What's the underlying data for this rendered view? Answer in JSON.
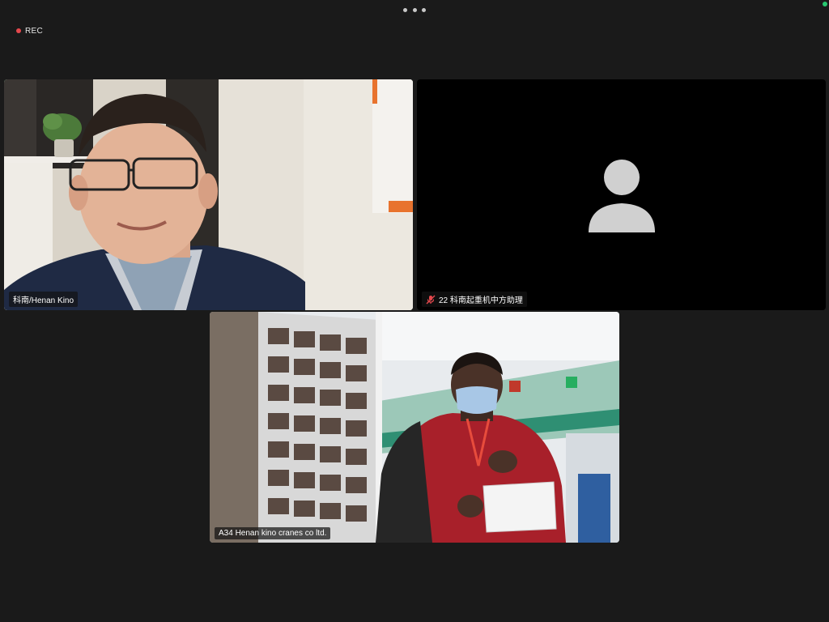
{
  "toolbar": {
    "more_glyph": "more-horizontal-icon"
  },
  "recording": {
    "label": "REC",
    "color": "#e5484d"
  },
  "connection": {
    "status_color": "#28c76f"
  },
  "tiles": [
    {
      "name": "科南/Henan Kino",
      "active": true,
      "video": true,
      "muted": false
    },
    {
      "name": "22 科南起重机中方助理",
      "active": false,
      "video": false,
      "muted": true,
      "avatar_icon": "user-silhouette-icon"
    },
    {
      "name": "A34 Henan kino cranes co ltd.",
      "active": false,
      "video": true,
      "muted": false
    }
  ],
  "colors": {
    "active_speaker": "#2ecc71",
    "muted_icon": "#e5484d",
    "background": "#1a1a1a"
  }
}
